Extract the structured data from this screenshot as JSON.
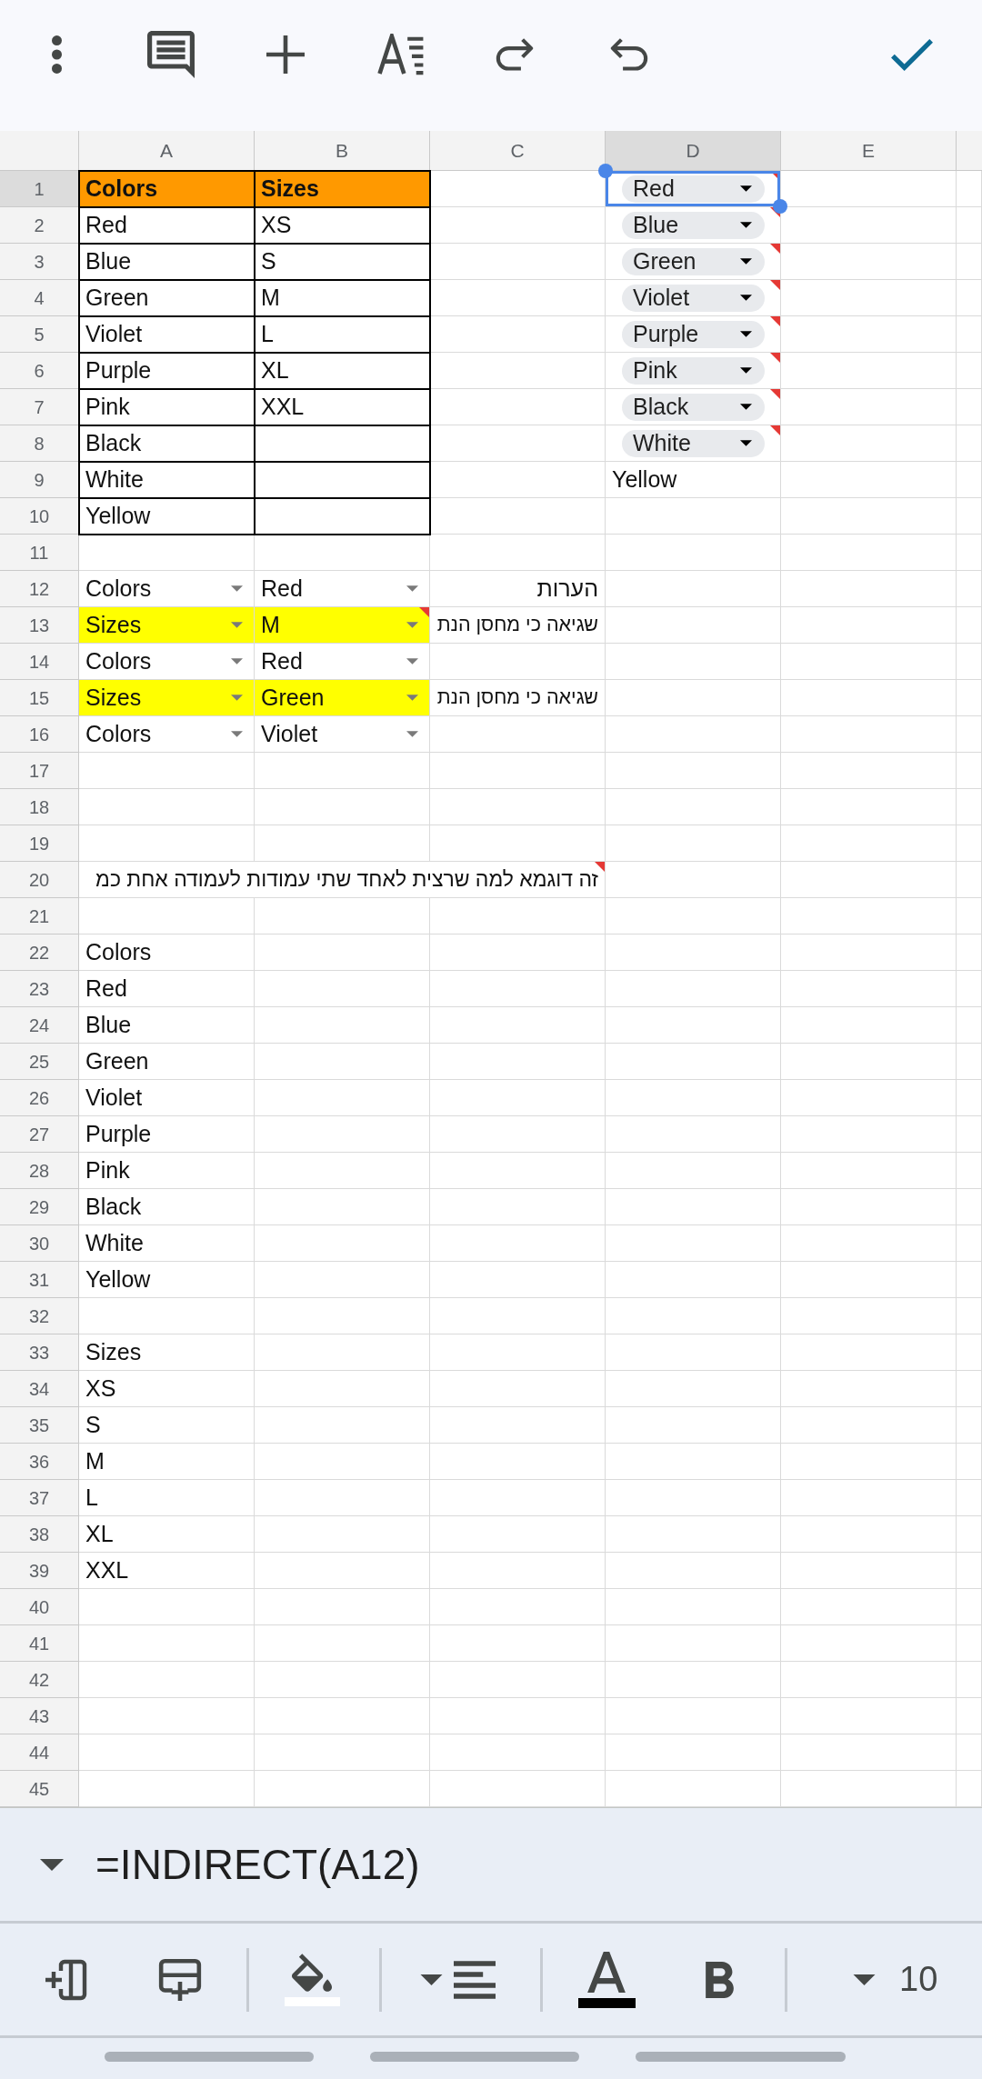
{
  "sheet": {
    "columns": [
      {
        "label": "A",
        "selected": false
      },
      {
        "label": "B",
        "selected": false
      },
      {
        "label": "C",
        "selected": false
      },
      {
        "label": "D",
        "selected": true
      },
      {
        "label": "E",
        "selected": false
      }
    ],
    "rows": [
      {
        "label": "1",
        "selected": true,
        "cells": [
          {
            "kind": "text",
            "text": "Colors",
            "bold": true,
            "color": "#ff9900",
            "bordered": true,
            "invalid": false,
            "selected": false
          },
          {
            "kind": "text",
            "text": "Sizes",
            "bold": true,
            "color": "#ff9900",
            "bordered": true,
            "invalid": false,
            "selected": false
          },
          {
            "kind": "empty",
            "bordered": false,
            "invalid": false,
            "selected": false
          },
          {
            "kind": "chip",
            "text": "Red",
            "bold": false,
            "bordered": false,
            "invalid": true,
            "selected": true
          }
        ]
      },
      {
        "label": "2",
        "selected": false,
        "cells": [
          {
            "kind": "text",
            "text": "Red",
            "bold": false,
            "bordered": true,
            "invalid": false,
            "selected": false
          },
          {
            "kind": "text",
            "text": "XS",
            "bold": false,
            "bordered": true,
            "invalid": false,
            "selected": false
          },
          {
            "kind": "empty",
            "bordered": false,
            "invalid": false,
            "selected": false
          },
          {
            "kind": "chip",
            "text": "Blue",
            "bold": false,
            "bordered": false,
            "invalid": true,
            "selected": false
          }
        ]
      },
      {
        "label": "3",
        "selected": false,
        "cells": [
          {
            "kind": "text",
            "text": "Blue",
            "bold": false,
            "bordered": true,
            "invalid": false,
            "selected": false
          },
          {
            "kind": "text",
            "text": "S",
            "bold": false,
            "bordered": true,
            "invalid": false,
            "selected": false
          },
          {
            "kind": "empty",
            "bordered": false,
            "invalid": false,
            "selected": false
          },
          {
            "kind": "chip",
            "text": "Green",
            "bold": false,
            "bordered": false,
            "invalid": true,
            "selected": false
          }
        ]
      },
      {
        "label": "4",
        "selected": false,
        "cells": [
          {
            "kind": "text",
            "text": "Green",
            "bold": false,
            "bordered": true,
            "invalid": false,
            "selected": false
          },
          {
            "kind": "text",
            "text": "M",
            "bold": false,
            "bordered": true,
            "invalid": false,
            "selected": false
          },
          {
            "kind": "empty",
            "bordered": false,
            "invalid": false,
            "selected": false
          },
          {
            "kind": "chip",
            "text": "Violet",
            "bold": false,
            "bordered": false,
            "invalid": true,
            "selected": false
          }
        ]
      },
      {
        "label": "5",
        "selected": false,
        "cells": [
          {
            "kind": "text",
            "text": "Violet",
            "bold": false,
            "bordered": true,
            "invalid": false,
            "selected": false
          },
          {
            "kind": "text",
            "text": "L",
            "bold": false,
            "bordered": true,
            "invalid": false,
            "selected": false
          },
          {
            "kind": "empty",
            "bordered": false,
            "invalid": false,
            "selected": false
          },
          {
            "kind": "chip",
            "text": "Purple",
            "bold": false,
            "bordered": false,
            "invalid": true,
            "selected": false
          }
        ]
      },
      {
        "label": "6",
        "selected": false,
        "cells": [
          {
            "kind": "text",
            "text": "Purple",
            "bold": false,
            "bordered": true,
            "invalid": false,
            "selected": false
          },
          {
            "kind": "text",
            "text": "XL",
            "bold": false,
            "bordered": true,
            "invalid": false,
            "selected": false
          },
          {
            "kind": "empty",
            "bordered": false,
            "invalid": false,
            "selected": false
          },
          {
            "kind": "chip",
            "text": "Pink",
            "bold": false,
            "bordered": false,
            "invalid": true,
            "selected": false
          }
        ]
      },
      {
        "label": "7",
        "selected": false,
        "cells": [
          {
            "kind": "text",
            "text": "Pink",
            "bold": false,
            "bordered": true,
            "invalid": false,
            "selected": false
          },
          {
            "kind": "text",
            "text": "XXL",
            "bold": false,
            "bordered": true,
            "invalid": false,
            "selected": false
          },
          {
            "kind": "empty",
            "bordered": false,
            "invalid": false,
            "selected": false
          },
          {
            "kind": "chip",
            "text": "Black",
            "bold": false,
            "bordered": false,
            "invalid": true,
            "selected": false
          }
        ]
      },
      {
        "label": "8",
        "selected": false,
        "cells": [
          {
            "kind": "text",
            "text": "Black",
            "bold": false,
            "bordered": true,
            "invalid": false,
            "selected": false
          },
          {
            "kind": "empty",
            "bordered": true,
            "invalid": false,
            "selected": false
          },
          {
            "kind": "empty",
            "bordered": false,
            "invalid": false,
            "selected": false
          },
          {
            "kind": "chip",
            "text": "White",
            "bold": false,
            "bordered": false,
            "invalid": true,
            "selected": false
          }
        ]
      },
      {
        "label": "9",
        "selected": false,
        "cells": [
          {
            "kind": "text",
            "text": "White",
            "bold": false,
            "bordered": true,
            "invalid": false,
            "selected": false
          },
          {
            "kind": "empty",
            "bordered": true,
            "invalid": false,
            "selected": false
          },
          {
            "kind": "empty",
            "bordered": false,
            "invalid": false,
            "selected": false
          },
          {
            "kind": "text",
            "text": "Yellow",
            "bold": false,
            "bordered": false,
            "invalid": false,
            "selected": false
          }
        ]
      },
      {
        "label": "10",
        "selected": false,
        "cells": [
          {
            "kind": "text",
            "text": "Yellow",
            "bold": false,
            "bordered": true,
            "invalid": false,
            "selected": false
          },
          {
            "kind": "empty",
            "bordered": true,
            "invalid": false,
            "selected": false
          }
        ]
      },
      {
        "label": "11",
        "selected": false
      },
      {
        "label": "12",
        "selected": false,
        "cells": [
          {
            "kind": "dropdown",
            "text": "Colors",
            "bold": false,
            "bordered": false,
            "invalid": false,
            "selected": false
          },
          {
            "kind": "dropdown",
            "text": "Red",
            "bold": false,
            "bordered": false,
            "invalid": false,
            "selected": false
          },
          {
            "kind": "text",
            "text": "הערות",
            "bold": false,
            "bordered": false,
            "invalid": false,
            "selected": false
          }
        ]
      },
      {
        "label": "13",
        "selected": false,
        "cells": [
          {
            "kind": "dropdown",
            "text": "Sizes",
            "bold": false,
            "color": "#ffff00",
            "bordered": false,
            "invalid": false,
            "selected": false
          },
          {
            "kind": "dropdown",
            "text": "M",
            "bold": false,
            "color": "#ffff00",
            "bordered": false,
            "invalid": true,
            "selected": false
          },
          {
            "kind": "text",
            "text": "שגיאה כי מחסן הנת",
            "bold": false,
            "bordered": false,
            "invalid": false,
            "selected": false
          }
        ]
      },
      {
        "label": "14",
        "selected": false,
        "cells": [
          {
            "kind": "dropdown",
            "text": "Colors",
            "bold": false,
            "bordered": false,
            "invalid": false,
            "selected": false
          },
          {
            "kind": "dropdown",
            "text": "Red",
            "bold": false,
            "bordered": false,
            "invalid": false,
            "selected": false
          }
        ]
      },
      {
        "label": "15",
        "selected": false,
        "cells": [
          {
            "kind": "dropdown",
            "text": "Sizes",
            "bold": false,
            "color": "#ffff00",
            "bordered": false,
            "invalid": false,
            "selected": false
          },
          {
            "kind": "dropdown",
            "text": "Green",
            "bold": false,
            "color": "#ffff00",
            "bordered": false,
            "invalid": false,
            "selected": false
          },
          {
            "kind": "text",
            "text": "שגיאה כי מחסן הנת",
            "bold": false,
            "bordered": false,
            "invalid": false,
            "selected": false
          }
        ]
      },
      {
        "label": "16",
        "selected": false,
        "cells": [
          {
            "kind": "dropdown",
            "text": "Colors",
            "bold": false,
            "bordered": false,
            "invalid": false,
            "selected": false
          },
          {
            "kind": "dropdown",
            "text": "Violet",
            "bold": false,
            "bordered": false,
            "invalid": false,
            "selected": false
          }
        ]
      },
      {
        "label": "17",
        "selected": false
      },
      {
        "label": "18",
        "selected": false
      },
      {
        "label": "19",
        "selected": false
      },
      {
        "label": "20",
        "selected": false,
        "cells": [
          {
            "kind": "empty",
            "bordered": false,
            "invalid": false,
            "selected": false
          },
          {
            "kind": "empty",
            "bordered": false,
            "invalid": false,
            "selected": false
          },
          {
            "kind": "wide",
            "text": "זה דוגמא למה שרצית לאחד שתי עמודות לעמודה אחת כמ",
            "bold": false,
            "bordered": false,
            "invalid": true,
            "selected": false
          }
        ]
      },
      {
        "label": "21",
        "selected": false
      },
      {
        "label": "22",
        "selected": false,
        "cells": [
          {
            "kind": "text",
            "text": "Colors",
            "bold": false,
            "bordered": false,
            "invalid": false,
            "selected": false
          }
        ]
      },
      {
        "label": "23",
        "selected": false,
        "cells": [
          {
            "kind": "text",
            "text": "Red",
            "bold": false,
            "bordered": false,
            "invalid": false,
            "selected": false
          }
        ]
      },
      {
        "label": "24",
        "selected": false,
        "cells": [
          {
            "kind": "text",
            "text": "Blue",
            "bold": false,
            "bordered": false,
            "invalid": false,
            "selected": false
          }
        ]
      },
      {
        "label": "25",
        "selected": false,
        "cells": [
          {
            "kind": "text",
            "text": "Green",
            "bold": false,
            "bordered": false,
            "invalid": false,
            "selected": false
          }
        ]
      },
      {
        "label": "26",
        "selected": false,
        "cells": [
          {
            "kind": "text",
            "text": "Violet",
            "bold": false,
            "bordered": false,
            "invalid": false,
            "selected": false
          }
        ]
      },
      {
        "label": "27",
        "selected": false,
        "cells": [
          {
            "kind": "text",
            "text": "Purple",
            "bold": false,
            "bordered": false,
            "invalid": false,
            "selected": false
          }
        ]
      },
      {
        "label": "28",
        "selected": false,
        "cells": [
          {
            "kind": "text",
            "text": "Pink",
            "bold": false,
            "bordered": false,
            "invalid": false,
            "selected": false
          }
        ]
      },
      {
        "label": "29",
        "selected": false,
        "cells": [
          {
            "kind": "text",
            "text": "Black",
            "bold": false,
            "bordered": false,
            "invalid": false,
            "selected": false
          }
        ]
      },
      {
        "label": "30",
        "selected": false,
        "cells": [
          {
            "kind": "text",
            "text": "White",
            "bold": false,
            "bordered": false,
            "invalid": false,
            "selected": false
          }
        ]
      },
      {
        "label": "31",
        "selected": false,
        "cells": [
          {
            "kind": "text",
            "text": "Yellow",
            "bold": false,
            "bordered": false,
            "invalid": false,
            "selected": false
          }
        ]
      },
      {
        "label": "32",
        "selected": false
      },
      {
        "label": "33",
        "selected": false,
        "cells": [
          {
            "kind": "text",
            "text": "Sizes",
            "bold": false,
            "bordered": false,
            "invalid": false,
            "selected": false
          }
        ]
      },
      {
        "label": "34",
        "selected": false,
        "cells": [
          {
            "kind": "text",
            "text": "XS",
            "bold": false,
            "bordered": false,
            "invalid": false,
            "selected": false
          }
        ]
      },
      {
        "label": "35",
        "selected": false,
        "cells": [
          {
            "kind": "text",
            "text": "S",
            "bold": false,
            "bordered": false,
            "invalid": false,
            "selected": false
          }
        ]
      },
      {
        "label": "36",
        "selected": false,
        "cells": [
          {
            "kind": "text",
            "text": "M",
            "bold": false,
            "bordered": false,
            "invalid": false,
            "selected": false
          }
        ]
      },
      {
        "label": "37",
        "selected": false,
        "cells": [
          {
            "kind": "text",
            "text": "L",
            "bold": false,
            "bordered": false,
            "invalid": false,
            "selected": false
          }
        ]
      },
      {
        "label": "38",
        "selected": false,
        "cells": [
          {
            "kind": "text",
            "text": "XL",
            "bold": false,
            "bordered": false,
            "invalid": false,
            "selected": false
          }
        ]
      },
      {
        "label": "39",
        "selected": false,
        "cells": [
          {
            "kind": "text",
            "text": "XXL",
            "bold": false,
            "bordered": false,
            "invalid": false,
            "selected": false
          }
        ]
      },
      {
        "label": "40",
        "selected": false
      },
      {
        "label": "41",
        "selected": false
      },
      {
        "label": "42",
        "selected": false
      },
      {
        "label": "43",
        "selected": false
      },
      {
        "label": "44",
        "selected": false
      },
      {
        "label": "45",
        "selected": false
      }
    ]
  },
  "formula_bar": {
    "text": "=INDIRECT(A12)"
  },
  "format_toolbar": {
    "fill_swatch": {
      "color": "#ffffff"
    },
    "text_swatch": {
      "color": "#000000"
    },
    "font_size": "10"
  }
}
